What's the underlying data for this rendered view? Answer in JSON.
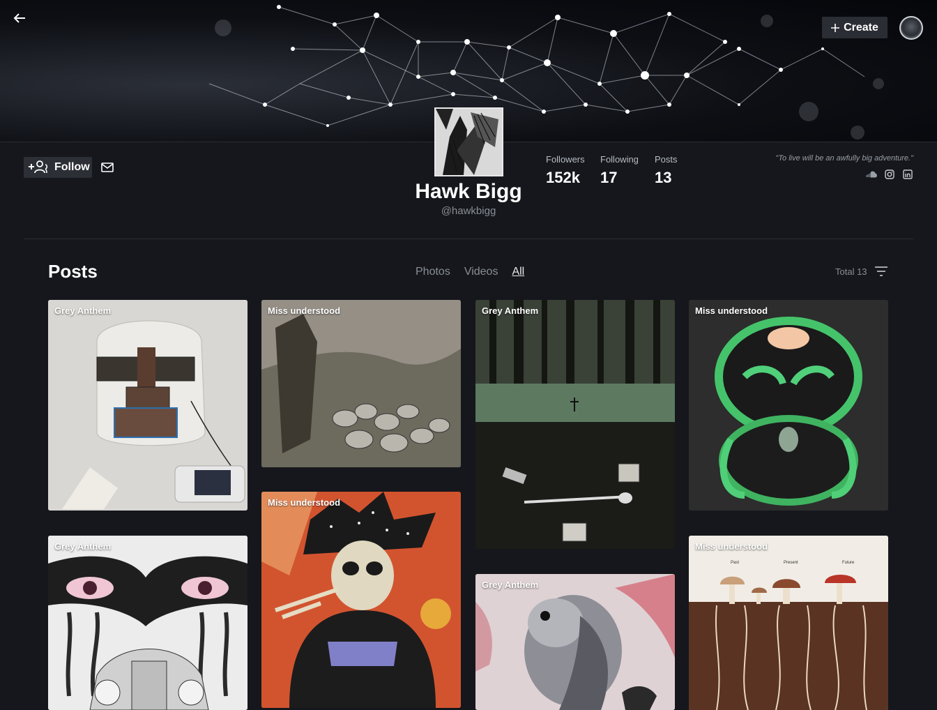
{
  "header": {
    "create_label": "Create"
  },
  "profile": {
    "display_name": "Hawk Bigg",
    "username": "@hawkbigg",
    "follow_label": "Follow",
    "quote": "\"To live will be an awfully big adventure.\"",
    "stats": [
      {
        "label": "Followers",
        "value": "152k"
      },
      {
        "label": "Following",
        "value": "17"
      },
      {
        "label": "Posts",
        "value": "13"
      }
    ],
    "socials": [
      "soundcloud-icon",
      "instagram-icon",
      "linkedin-icon"
    ]
  },
  "posts": {
    "title": "Posts",
    "tabs": [
      {
        "label": "Photos",
        "active": false
      },
      {
        "label": "Videos",
        "active": false
      },
      {
        "label": "All",
        "active": true
      }
    ],
    "total_label": "Total 13",
    "cards": [
      {
        "label": "Grey Anthem"
      },
      {
        "label": "Miss understood"
      },
      {
        "label": "Grey Anthem"
      },
      {
        "label": "Miss understood"
      },
      {
        "label": "Grey Anthem"
      },
      {
        "label": "Miss understood"
      },
      {
        "label": "Grey Anthem"
      },
      {
        "label": "Miss understood"
      }
    ]
  },
  "colors": {
    "background": "#15171c",
    "button": "#2c2f35",
    "muted_text": "#8a8e96"
  }
}
